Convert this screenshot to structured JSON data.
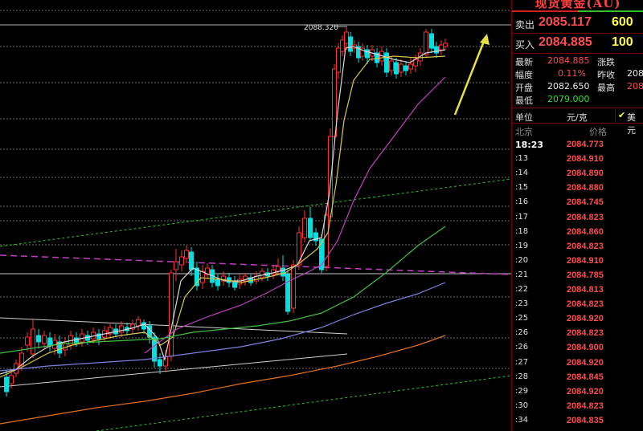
{
  "chart_data": {
    "type": "candlestick",
    "peak_label": "2088.320"
  },
  "panel": {
    "title": "现货黄金(AU)",
    "sell": {
      "label": "卖出",
      "price": "2085.117",
      "volume": "600"
    },
    "buy": {
      "label": "买入",
      "price": "2084.885",
      "volume": "100"
    },
    "stats": {
      "latest_label": "最新",
      "latest": "2084.885",
      "change_label": "涨跌",
      "amplitude_label": "幅度",
      "amplitude": "0.11%",
      "prev_close_label": "昨收",
      "prev_close": "208",
      "open_label": "开盘",
      "open": "2082.650",
      "high_label": "最高",
      "high": "208",
      "low_label": "最低",
      "low": "2079.000"
    },
    "unit_label": "单位",
    "unit_value": "元/克",
    "currency_label": "美元",
    "tick_header": {
      "place": "北京",
      "price": "价格"
    },
    "ticks": [
      {
        "time": "18:23",
        "price": "2084.773"
      },
      {
        "time": ":13",
        "price": "2084.910"
      },
      {
        "time": ":14",
        "price": "2084.890"
      },
      {
        "time": ":15",
        "price": "2084.880"
      },
      {
        "time": ":16",
        "price": "2084.745"
      },
      {
        "time": ":17",
        "price": "2084.823"
      },
      {
        "time": ":18",
        "price": "2084.860"
      },
      {
        "time": ":19",
        "price": "2084.823"
      },
      {
        "time": ":20",
        "price": "2084.910"
      },
      {
        "time": ":21",
        "price": "2084.785"
      },
      {
        "time": ":22",
        "price": "2084.813"
      },
      {
        "time": ":23",
        "price": "2084.823"
      },
      {
        "time": ":25",
        "price": "2084.920"
      },
      {
        "time": ":26",
        "price": "2084.823"
      },
      {
        "time": ":26",
        "price": "2084.900"
      },
      {
        "time": ":27",
        "price": "2084.920"
      },
      {
        "time": ":28",
        "price": "2084.845"
      },
      {
        "time": ":29",
        "price": "2084.920"
      },
      {
        "time": ":30",
        "price": "2084.823"
      },
      {
        "time": ":34",
        "price": "2084.835"
      }
    ]
  },
  "colors": {
    "up": "#ff3030",
    "down": "#00e0e0",
    "ma_white": "#d8d8d8",
    "ma_yellow": "#d8c850",
    "ma_purple": "#c040c0",
    "ma_green": "#40c040",
    "ma_blue": "#8080e0",
    "ma_orange": "#e07020",
    "arrow": "#e8e040"
  }
}
